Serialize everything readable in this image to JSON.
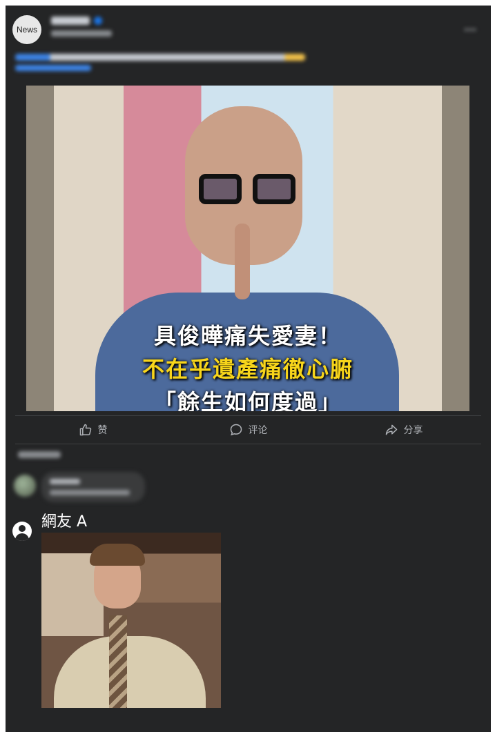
{
  "post": {
    "avatar_text": "News",
    "image_overlay": {
      "line1": "具俊曄痛失愛妻！",
      "line2": "不在乎遺產痛徹心腑",
      "line3": "「餘生如何度過」"
    },
    "actions": [
      {
        "label": "赞",
        "icon": "thumbs-up-icon"
      },
      {
        "label": "评论",
        "icon": "comment-icon"
      },
      {
        "label": "分享",
        "icon": "share-icon"
      }
    ]
  },
  "comment": {
    "author": "網友 A",
    "avatar_icon": "user-icon"
  },
  "colors": {
    "background": "#242526",
    "overlay_yellow": "#f7d51b",
    "verified_blue": "#1b74e4"
  }
}
